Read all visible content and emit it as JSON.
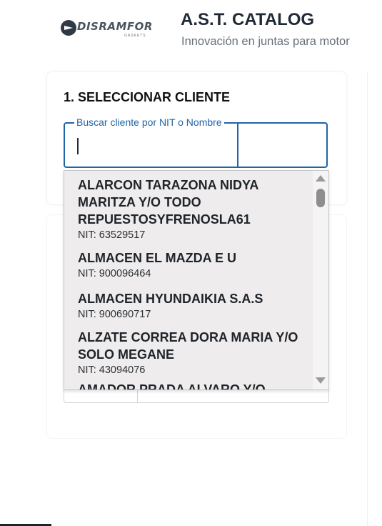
{
  "brand": {
    "logo_text": "DISRAMFOR",
    "logo_sub": "GASKETS",
    "title": "A.S.T. CATALOG",
    "subtitle": "Innovación en juntas para motor"
  },
  "section": {
    "title": "1. SELECCIONAR CLIENTE"
  },
  "search": {
    "label": "Buscar cliente por NIT o Nombre",
    "value": ""
  },
  "dropdown": {
    "options": [
      {
        "name": "ALARCON TARAZONA NIDYA MARITZA Y/O TODO REPUESTOSYFRENOSLA61",
        "nit": "NIT: 63529517"
      },
      {
        "name": "ALMACEN EL MAZDA E U",
        "nit": "NIT: 900096464"
      },
      {
        "name": "ALMACEN HYUNDAIKIA S.A.S",
        "nit": "NIT: 900690717"
      },
      {
        "name": "ALZATE CORREA DORA MARIA Y/O SOLO MEGANE",
        "nit": "NIT: 43094076"
      },
      {
        "name": "AMADOR PRADA ALVARO Y/O",
        "nit": ""
      }
    ]
  },
  "colors": {
    "accent": "#1f64a6",
    "dropdown_bg": "#eeeced"
  }
}
